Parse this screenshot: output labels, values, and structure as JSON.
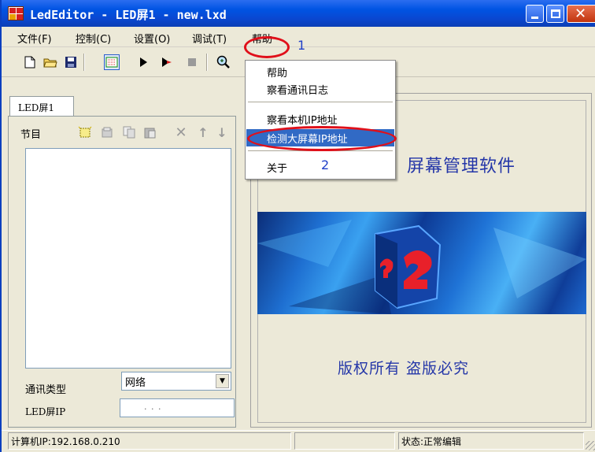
{
  "window": {
    "title": "LedEditor - LED屏1 - new.lxd"
  },
  "menubar": {
    "items": [
      {
        "label": "文件(F)"
      },
      {
        "label": "控制(C)"
      },
      {
        "label": "设置(O)"
      },
      {
        "label": "调试(T)"
      },
      {
        "label": "帮助"
      }
    ]
  },
  "help_menu": {
    "items": [
      {
        "label": "帮助"
      },
      {
        "label": "察看通讯日志"
      },
      {
        "label": "察看本机IP地址"
      },
      {
        "label": "检测大屏幕IP地址",
        "selected": true
      },
      {
        "label": "关于"
      }
    ]
  },
  "annotations": {
    "step1": "1",
    "step2": "2",
    "highlight_color": "#e0101a",
    "label_color": "#1f3fc8"
  },
  "toolbar": {
    "icons": [
      "new-file-icon",
      "open-folder-icon",
      "save-icon",
      "screen-grid-icon",
      "play-icon",
      "play-step-icon",
      "stop-icon",
      "zoom-icon"
    ]
  },
  "left_panel": {
    "tab_label": "LED屏1",
    "program_label": "节目",
    "program_icons": [
      "new-program-icon",
      "copy-program-icon",
      "copy-icon",
      "paste-icon",
      "delete-icon",
      "move-up-icon",
      "move-down-icon"
    ],
    "comm_type_label": "通讯类型",
    "comm_type_value": "网络",
    "led_ip_label": "LED屏IP",
    "led_ip_value": ".   .   ."
  },
  "right_panel": {
    "brand_text": "屏幕管理软件",
    "copyright_text": "版权所有 盗版必究"
  },
  "statusbar": {
    "computer_ip": "计算机IP:192.168.0.210",
    "middle": "",
    "status": "状态:正常编辑"
  },
  "colors": {
    "selection": "#316ac5",
    "titlebar": "#0054e3",
    "brand_text": "#2436a8"
  }
}
